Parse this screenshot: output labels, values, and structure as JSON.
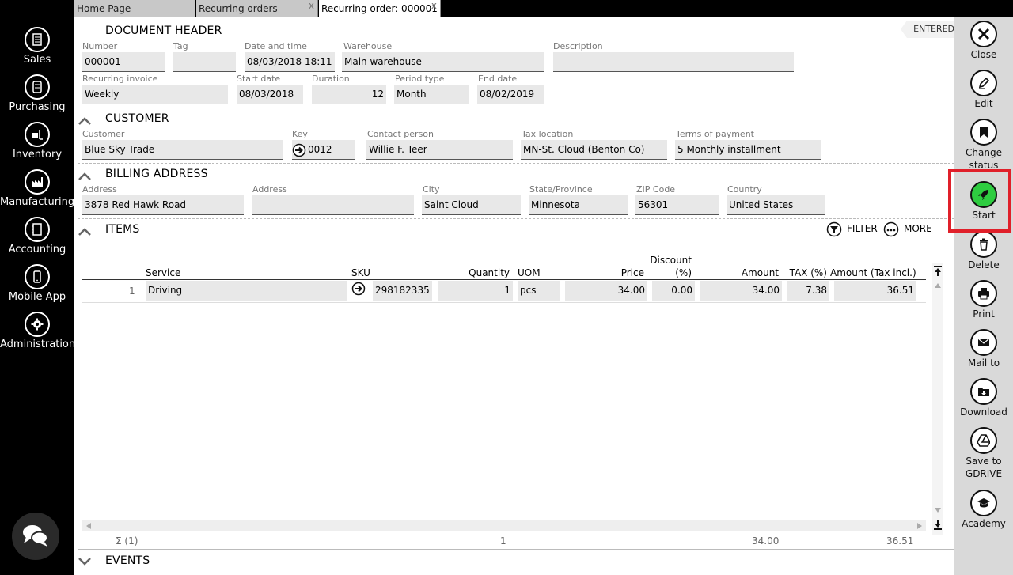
{
  "tabs": [
    {
      "label": "Home Page",
      "closable": false
    },
    {
      "label": "Recurring orders",
      "closable": true
    },
    {
      "label": "Recurring order: 000001",
      "closable": true,
      "active": true
    }
  ],
  "close_glyph": "x",
  "left_nav": [
    {
      "label": "Sales",
      "icon": "sales-icon"
    },
    {
      "label": "Purchasing",
      "icon": "purchasing-icon"
    },
    {
      "label": "Inventory",
      "icon": "inventory-icon"
    },
    {
      "label": "Manufacturing",
      "icon": "manufacturing-icon"
    },
    {
      "label": "Accounting",
      "icon": "accounting-icon"
    },
    {
      "label": "Mobile App",
      "icon": "mobile-app-icon"
    },
    {
      "label": "Administration",
      "icon": "gear-icon"
    }
  ],
  "status": "ENTERED",
  "document_header": {
    "title": "DOCUMENT HEADER",
    "number_label": "Number",
    "number": "000001",
    "tag_label": "Tag",
    "tag": "",
    "datetime_label": "Date and time",
    "datetime": "08/03/2018 18:11",
    "warehouse_label": "Warehouse",
    "warehouse": "Main warehouse",
    "description_label": "Description",
    "description": "",
    "recurring_label": "Recurring invoice",
    "recurring": "Weekly",
    "start_label": "Start date",
    "start": "08/03/2018",
    "duration_label": "Duration",
    "duration": "12",
    "period_label": "Period type",
    "period": "Month",
    "end_label": "End date",
    "end": "08/02/2019"
  },
  "customer": {
    "title": "CUSTOMER",
    "customer_label": "Customer",
    "customer": "Blue Sky Trade",
    "key_label": "Key",
    "key": "0012",
    "contact_label": "Contact person",
    "contact": "Willie F. Teer",
    "tax_label": "Tax location",
    "tax": "MN-St. Cloud (Benton Co)",
    "terms_label": "Terms of payment",
    "terms": "5 Monthly installment"
  },
  "billing": {
    "title": "BILLING ADDRESS",
    "address1_label": "Address",
    "address1": "3878 Red Hawk Road",
    "address2_label": "Address",
    "address2": "",
    "city_label": "City",
    "city": "Saint Cloud",
    "state_label": "State/Province",
    "state": "Minnesota",
    "zip_label": "ZIP Code",
    "zip": "56301",
    "country_label": "Country",
    "country": "United States"
  },
  "items": {
    "title": "ITEMS",
    "filter_label": "FILTER",
    "more_label": "MORE",
    "columns": {
      "service": "Service",
      "sku": "SKU",
      "quantity": "Quantity",
      "uom": "UOM",
      "price": "Price",
      "discount_line1": "Discount",
      "discount_line2": "(%)",
      "amount": "Amount",
      "tax": "TAX (%)",
      "amount_tax": "Amount (Tax incl.)"
    },
    "rows": [
      {
        "no": "1",
        "service": "Driving",
        "sku": "298182335",
        "quantity": "1",
        "uom": "pcs",
        "price": "34.00",
        "discount": "0.00",
        "amount": "34.00",
        "tax": "7.38",
        "amount_tax": "36.51"
      }
    ],
    "footer": {
      "count": "Σ (1)",
      "quantity": "1",
      "amount": "34.00",
      "amount_tax": "36.51"
    }
  },
  "events": {
    "title": "EVENTS"
  },
  "actions": [
    {
      "label": "Close",
      "icon": "close-icon"
    },
    {
      "label": "Edit",
      "icon": "edit-icon"
    },
    {
      "label": "Change status",
      "icon": "bookmark-icon"
    },
    {
      "label": "Start",
      "icon": "rocket-icon",
      "highlighted": true
    },
    {
      "label": "Delete",
      "icon": "trash-icon"
    },
    {
      "label": "Print",
      "icon": "print-icon"
    },
    {
      "label": "Mail to",
      "icon": "mail-icon"
    },
    {
      "label": "Download",
      "icon": "download-icon"
    },
    {
      "label": "Save to GDRIVE",
      "icon": "gdrive-icon"
    },
    {
      "label": "Academy",
      "icon": "academy-icon"
    }
  ],
  "colors": {
    "start_accent": "#2ecc40",
    "highlight_border": "#e0202a"
  }
}
